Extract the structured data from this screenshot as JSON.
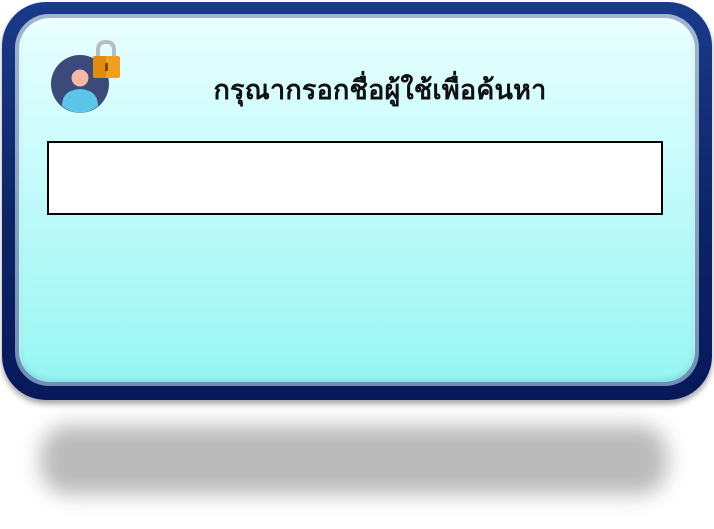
{
  "dialog": {
    "title": "กรุณากรอกชื่อผู้ใช้เพื่อค้นหา",
    "search": {
      "value": "",
      "placeholder": ""
    }
  },
  "icons": {
    "avatar": "user-lock-icon"
  },
  "colors": {
    "frame": "#0c2466",
    "panel_top": "#e9ffff",
    "panel_bottom": "#97f6f2",
    "avatar_bg": "#3a4a7a",
    "lock": "#f0a020"
  }
}
